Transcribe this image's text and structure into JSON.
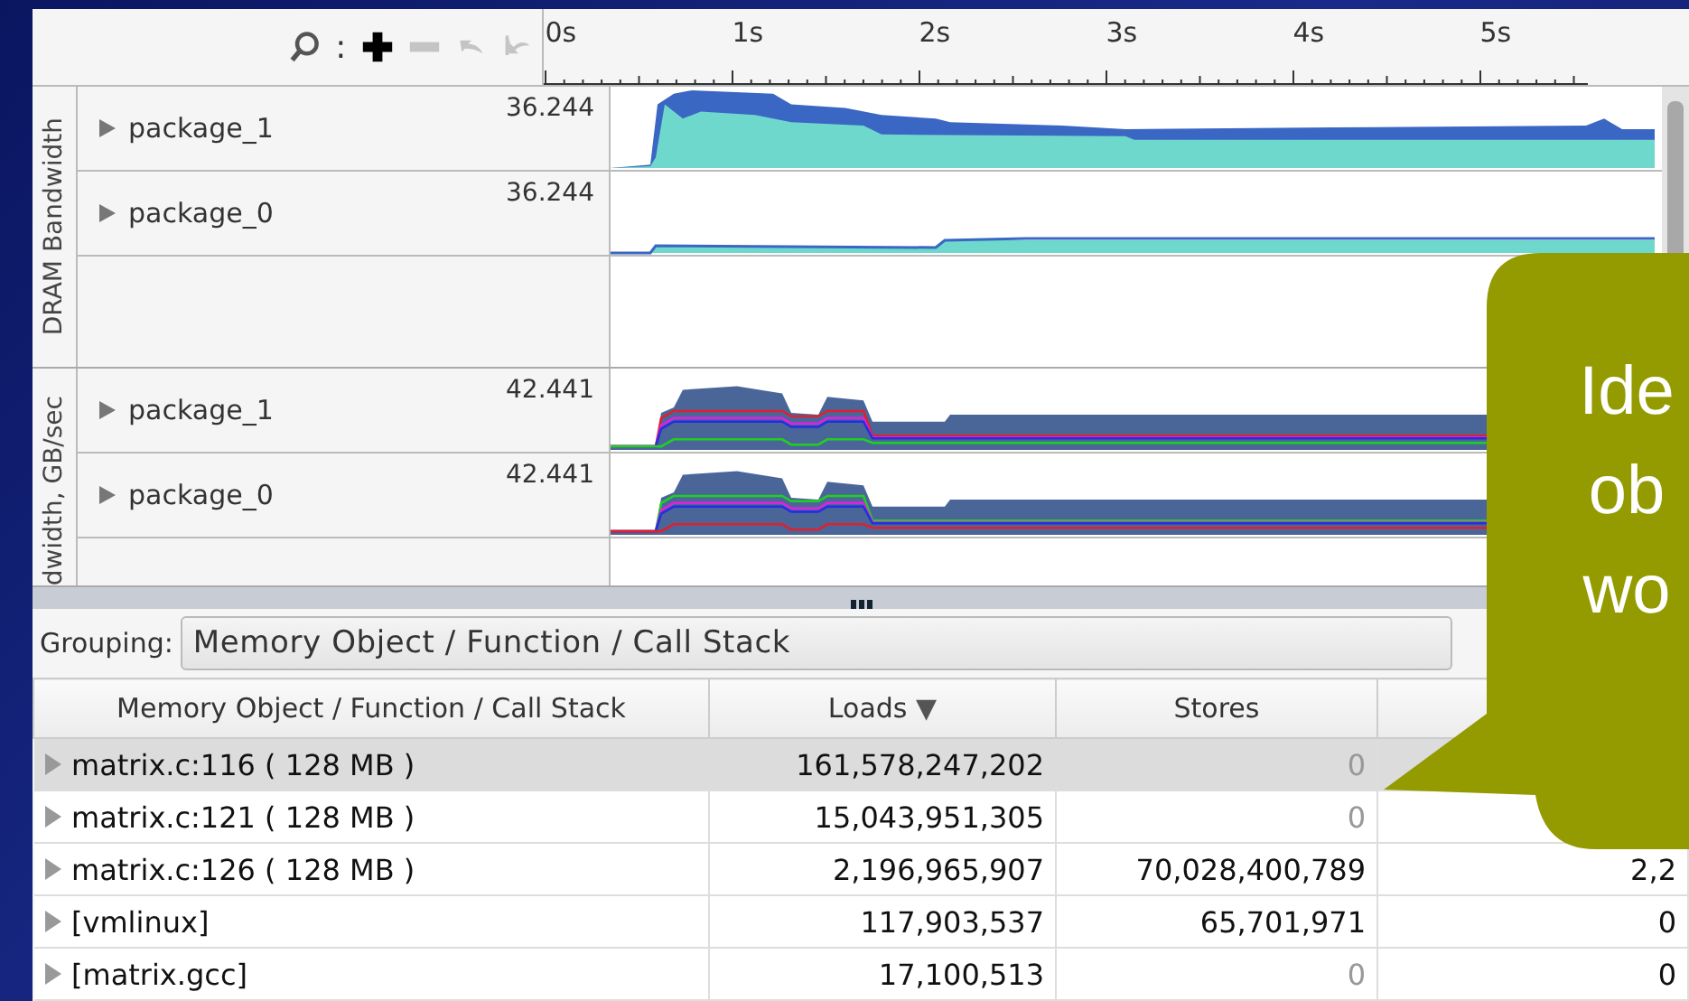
{
  "toolbar": {
    "separator": ":",
    "buttons": [
      {
        "kind": "search",
        "disabled": false
      },
      {
        "kind": "zoom-in",
        "disabled": false
      },
      {
        "kind": "zoom-out",
        "disabled": true
      },
      {
        "kind": "undo",
        "disabled": true
      },
      {
        "kind": "reset",
        "disabled": true
      }
    ]
  },
  "time_ticks": [
    "0s",
    "1s",
    "2s",
    "3s",
    "4s",
    "5s"
  ],
  "track_groups": [
    {
      "title": "DRAM Bandwidth",
      "tracks": [
        {
          "label": "package_1",
          "max": "36.244",
          "kind": "stacked"
        },
        {
          "label": "package_0",
          "max": "36.244",
          "kind": "stacked-low"
        }
      ]
    },
    {
      "title": "dwidth, GB/sec",
      "tracks": [
        {
          "label": "package_1",
          "max": "42.441",
          "kind": "lines-red"
        },
        {
          "label": "package_0",
          "max": "42.441",
          "kind": "lines-green"
        }
      ]
    }
  ],
  "grouping": {
    "label": "Grouping:",
    "value": "Memory Object / Function / Call Stack"
  },
  "table": {
    "columns": [
      {
        "label": "Memory Object / Function / Call Stack"
      },
      {
        "label": "Loads",
        "sort": "▼"
      },
      {
        "label": "Stores"
      }
    ],
    "rows": [
      {
        "name": "matrix.c:116 ( 128 MB )",
        "loads": "161,578,247,202",
        "stores": "0",
        "stores_dim": true,
        "selected": true
      },
      {
        "name": "matrix.c:121 ( 128 MB )",
        "loads": "15,043,951,305",
        "stores": "0",
        "stores_dim": true,
        "selected": false
      },
      {
        "name": "matrix.c:126 ( 128 MB )",
        "loads": "2,196,965,907",
        "stores": "70,028,400,789",
        "stores_dim": false,
        "selected": false,
        "column_4": "2,2"
      },
      {
        "name": "[vmlinux]",
        "loads": "117,903,537",
        "stores": "65,701,971",
        "stores_dim": false,
        "selected": false,
        "column_4": "0"
      },
      {
        "name": "[matrix.gcc]",
        "loads": "17,100,513",
        "stores": "0",
        "stores_dim": true,
        "selected": false,
        "column_4": "0"
      }
    ]
  },
  "callout": {
    "lines": [
      "Ide",
      "ob",
      "wo"
    ]
  }
}
